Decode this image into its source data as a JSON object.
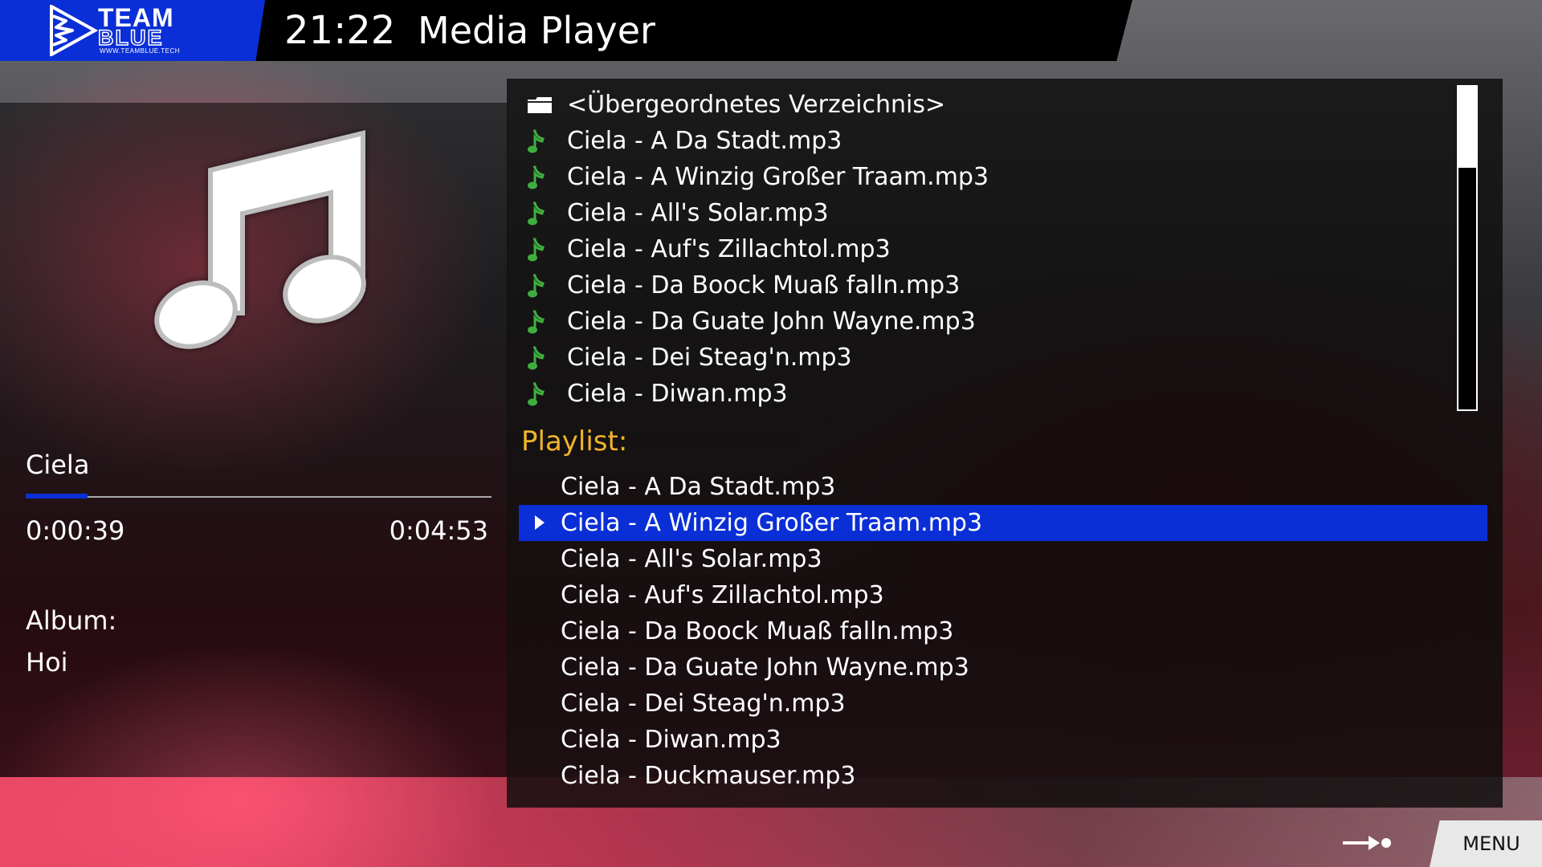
{
  "header": {
    "logo_team": "TEAM",
    "logo_blue": "BLUE",
    "logo_url": "WWW.TEAMBLUE.TECH",
    "clock": "21:22",
    "title": "Media Player"
  },
  "now_playing": {
    "icon": "music-note-icon",
    "artist": "Ciela",
    "progress_fraction": 0.133,
    "elapsed": "0:00:39",
    "total": "0:04:53",
    "album_label": "Album:",
    "album_value": "Hoi"
  },
  "file_browser": {
    "items": [
      {
        "icon": "folder-icon",
        "label": "<Übergeordnetes Verzeichnis>"
      },
      {
        "icon": "music-file-icon",
        "label": "Ciela - A Da Stadt.mp3"
      },
      {
        "icon": "music-file-icon",
        "label": "Ciela - A Winzig Großer Traam.mp3"
      },
      {
        "icon": "music-file-icon",
        "label": "Ciela - All's Solar.mp3"
      },
      {
        "icon": "music-file-icon",
        "label": "Ciela - Auf's Zillachtol.mp3"
      },
      {
        "icon": "music-file-icon",
        "label": "Ciela - Da Boock Muaß falln.mp3"
      },
      {
        "icon": "music-file-icon",
        "label": "Ciela - Da Guate John Wayne.mp3"
      },
      {
        "icon": "music-file-icon",
        "label": "Ciela - Dei Steag'n.mp3"
      },
      {
        "icon": "music-file-icon",
        "label": "Ciela - Diwan.mp3"
      }
    ],
    "scroll_thumb_fraction": 0.25
  },
  "playlist": {
    "title": "Playlist:",
    "selected_index": 1,
    "items": [
      "Ciela - A Da Stadt.mp3",
      "Ciela - A Winzig Großer Traam.mp3",
      "Ciela - All's Solar.mp3",
      "Ciela - Auf's Zillachtol.mp3",
      "Ciela - Da Boock Muaß falln.mp3",
      "Ciela - Da Guate John Wayne.mp3",
      "Ciela - Dei Steag'n.mp3",
      "Ciela - Diwan.mp3",
      "Ciela - Duckmauser.mp3"
    ]
  },
  "footer": {
    "key_icon": "arrow-right-dot-icon",
    "menu_label": "MENU"
  },
  "colors": {
    "accent_blue": "#0b2fd6",
    "playlist_title": "#f0b42a",
    "music_icon_green": "#3fae3f"
  }
}
